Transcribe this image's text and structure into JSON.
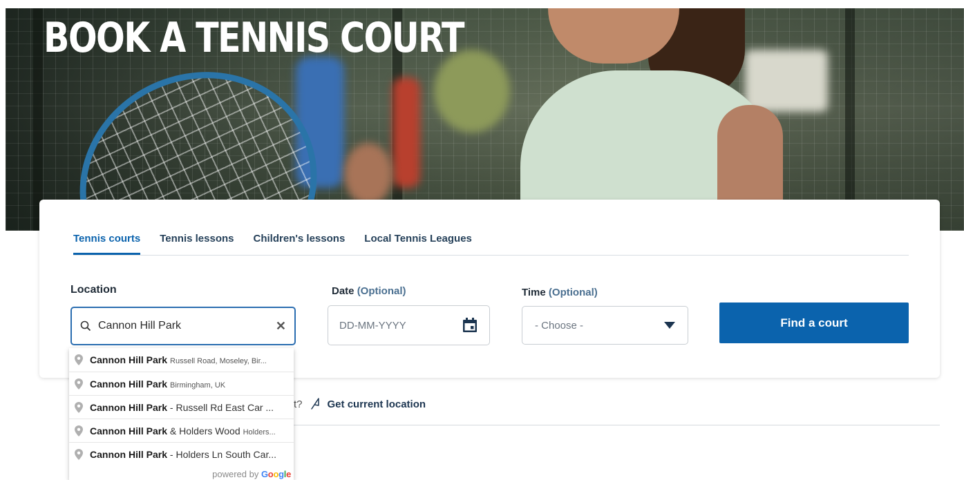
{
  "hero": {
    "title": "BOOK A TENNIS COURT"
  },
  "tabs": [
    {
      "label": "Tennis courts",
      "active": true
    },
    {
      "label": "Tennis lessons",
      "active": false
    },
    {
      "label": "Children's lessons",
      "active": false
    },
    {
      "label": "Local Tennis Leagues",
      "active": false
    }
  ],
  "location": {
    "label": "Location",
    "value": "Cannon Hill Park",
    "search_icon": "search-icon",
    "clear_icon": "close-icon"
  },
  "date": {
    "label": "Date",
    "optional": "(Optional)",
    "placeholder": "DD-MM-YYYY",
    "icon": "calendar-icon"
  },
  "time": {
    "label": "Time",
    "optional": "(Optional)",
    "value": "- Choose -",
    "icon": "caret-down-icon"
  },
  "find_button": "Find a court",
  "location_prompt": {
    "partial": "t?",
    "link": "Get current location",
    "icon": "navigation-arrow-icon"
  },
  "autocomplete": {
    "items": [
      {
        "main": "Cannon Hill Park",
        "rest": "",
        "secondary": "Russell Road, Moseley, Bir..."
      },
      {
        "main": "Cannon Hill Park",
        "rest": "",
        "secondary": "Birmingham, UK"
      },
      {
        "main": "Cannon Hill Park",
        "rest": " - Russell Rd East Car ...",
        "secondary": ""
      },
      {
        "main": "Cannon Hill Park",
        "rest": " & Holders Wood",
        "secondary": "Holders..."
      },
      {
        "main": "Cannon Hill Park",
        "rest": " - Holders Ln South Car...",
        "secondary": ""
      }
    ],
    "powered_by": "powered by",
    "google": "Google"
  },
  "colors": {
    "accent": "#0b63ad",
    "input_focus": "#2a6db0",
    "tab_text": "#26415a"
  }
}
